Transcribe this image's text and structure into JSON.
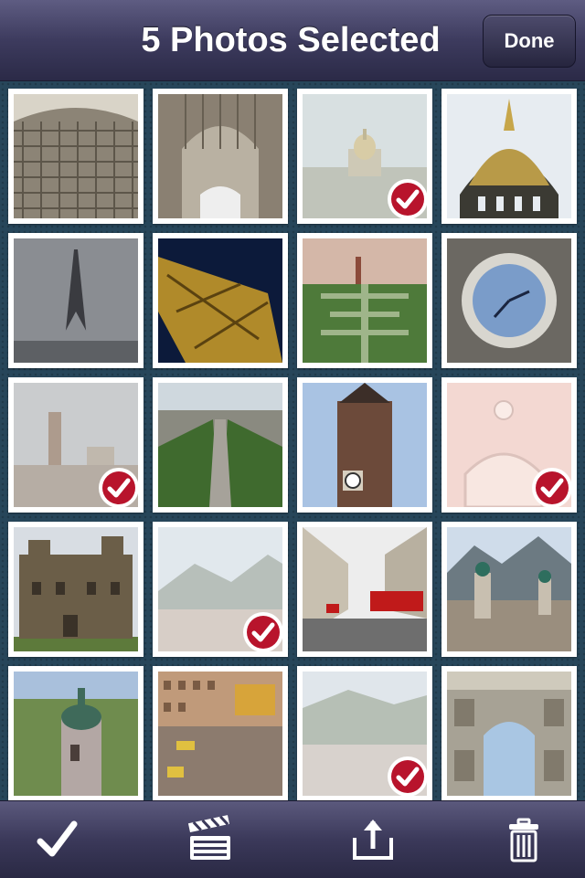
{
  "navbar": {
    "title": "5 Photos Selected",
    "done_label": "Done"
  },
  "colors": {
    "bar": "#3d3b5e",
    "background": "#27465a",
    "check": "#b8142c"
  },
  "photos": [
    {
      "name": "pantheon-ceiling",
      "selected": false
    },
    {
      "name": "arch-vault",
      "selected": false
    },
    {
      "name": "invalides-view",
      "selected": true
    },
    {
      "name": "golden-dome",
      "selected": false
    },
    {
      "name": "eiffel-tower",
      "selected": false
    },
    {
      "name": "eiffel-night",
      "selected": false
    },
    {
      "name": "champ-de-mars",
      "selected": false
    },
    {
      "name": "clock-face",
      "selected": false
    },
    {
      "name": "montparnasse-skyline",
      "selected": true
    },
    {
      "name": "champs-elysees",
      "selected": false
    },
    {
      "name": "clock-tower",
      "selected": false
    },
    {
      "name": "pink-ceiling",
      "selected": true
    },
    {
      "name": "castle",
      "selected": false
    },
    {
      "name": "mountain-town",
      "selected": true
    },
    {
      "name": "regent-street",
      "selected": false
    },
    {
      "name": "alpine-church",
      "selected": false
    },
    {
      "name": "church-towers",
      "selected": false
    },
    {
      "name": "golden-roof-square",
      "selected": false
    },
    {
      "name": "valley-town",
      "selected": true
    },
    {
      "name": "arc-de-triomphe",
      "selected": false
    }
  ],
  "toolbar": {
    "items": [
      "checkmark-icon",
      "clapperboard-icon",
      "share-icon",
      "trash-icon"
    ]
  }
}
